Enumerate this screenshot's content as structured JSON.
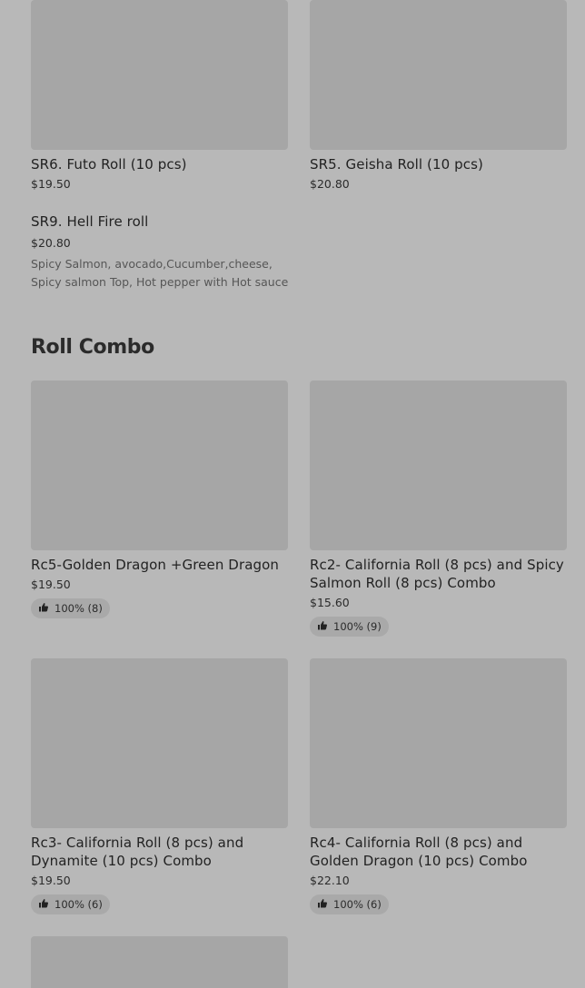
{
  "top_items": [
    {
      "name": "SR6. Futo Roll (10 pcs)",
      "price": "$19.50"
    },
    {
      "name": "SR5. Geisha Roll (10 pcs)",
      "price": "$20.80"
    },
    {
      "name": "SR9. Hell Fire roll",
      "price": "$20.80",
      "description": "Spicy Salmon, avocado,Cucumber,cheese, Spicy salmon Top, Hot pepper with Hot sauce"
    }
  ],
  "section": {
    "title": "Roll Combo"
  },
  "combo_items": [
    {
      "name": "Rc5-Golden Dragon +Green Dragon",
      "price": "$19.50",
      "rating": "100% (8)"
    },
    {
      "name": "Rc2- California Roll (8 pcs) and Spicy Salmon Roll (8 pcs) Combo",
      "price": "$15.60",
      "rating": "100% (9)"
    },
    {
      "name": "Rc3- California Roll (8 pcs) and Dynamite (10 pcs) Combo",
      "price": "$19.50",
      "rating": "100% (6)"
    },
    {
      "name": "Rc4- California Roll (8 pcs) and Golden Dragon (10 pcs) Combo",
      "price": "$22.10",
      "rating": "100% (6)"
    }
  ],
  "icons": {
    "rating": "thumbs-up-icon"
  },
  "colors": {
    "overlay_background": "#b8b8b8",
    "image_placeholder": "#a6a6a6"
  }
}
